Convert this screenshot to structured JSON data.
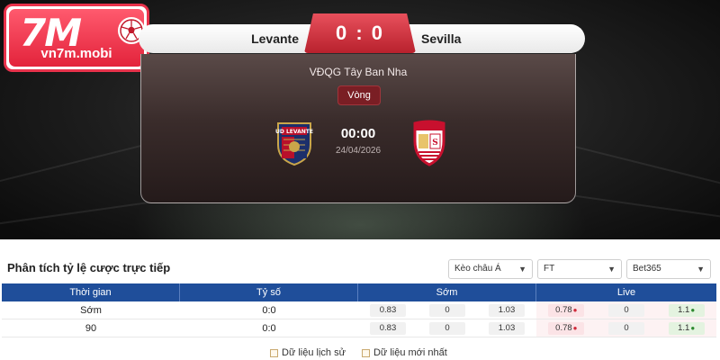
{
  "brand": {
    "logo_mark": "7M",
    "logo_domain": "vn7m.mobi"
  },
  "match": {
    "home_team": "Levante",
    "away_team": "Sevilla",
    "score": "0 : 0",
    "league": "VĐQG Tây Ban Nha",
    "round_label": "Vòng",
    "time": "00:00",
    "date": "24/04/2026",
    "home_crest_icon": "levante-crest-icon",
    "away_crest_icon": "sevilla-crest-icon"
  },
  "odds": {
    "title": "Phân tích tỷ lệ cược trực tiếp",
    "filters": {
      "market": "Kèo châu Á",
      "period": "FT",
      "bookmaker": "Bet365"
    },
    "columns": [
      "Thời gian",
      "Tỷ số",
      "Sớm",
      "Live"
    ],
    "rows": [
      {
        "time": "Sớm",
        "score": "0:0",
        "early": [
          "0.83",
          "0",
          "1.03"
        ],
        "live": [
          "0.78",
          "0",
          "1.1"
        ]
      },
      {
        "time": "90",
        "score": "0:0",
        "early": [
          "0.83",
          "0",
          "1.03"
        ],
        "live": [
          "0.78",
          "0",
          "1.1"
        ]
      }
    ],
    "legend": {
      "history": "Dữ liệu lịch sử",
      "latest": "Dữ liệu mới nhất"
    }
  },
  "colors": {
    "header_blue": "#1f4e9a",
    "score_red": "#c4303b",
    "brand_red": "#e3233b",
    "down_arrow": "#d0293a",
    "up_arrow": "#2e8a30"
  }
}
